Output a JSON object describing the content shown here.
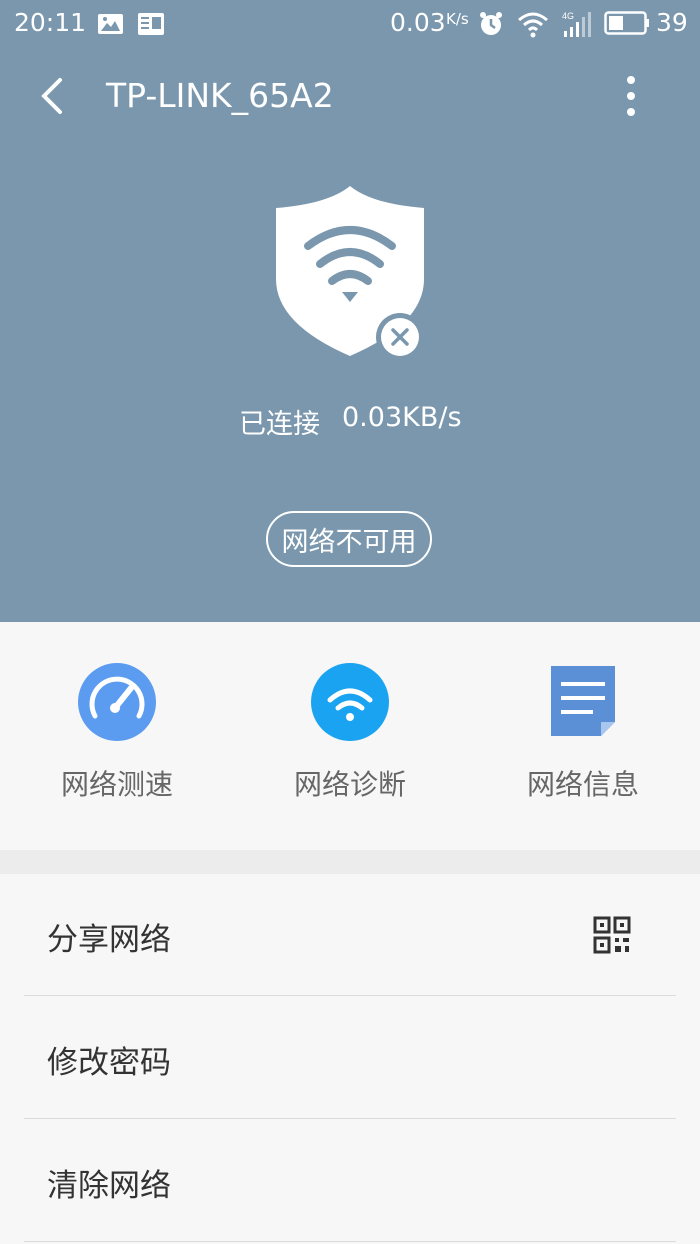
{
  "status_bar": {
    "time": "20:11",
    "net_speed": "0.03",
    "net_speed_unit": "K/s",
    "battery_level": "39",
    "icons": [
      "image-icon",
      "news-icon",
      "alarm-icon",
      "wifi-icon",
      "signal-4g-icon",
      "battery-icon"
    ]
  },
  "header": {
    "title": "TP-LINK_65A2",
    "back_icon": "chevron-left-icon",
    "more_icon": "more-vertical-icon"
  },
  "hero": {
    "shield_icon": "wifi-shield-icon",
    "status_text": "已连接",
    "speed_text": "0.03KB/s",
    "badge_text": "网络不可用",
    "bg_color": "#7a97ad"
  },
  "tools": [
    {
      "label": "网络测速",
      "icon": "speedometer-icon",
      "color": "#5b9bf0"
    },
    {
      "label": "网络诊断",
      "icon": "wifi-diagnose-icon",
      "color": "#1aa3f0"
    },
    {
      "label": "网络信息",
      "icon": "document-icon",
      "color": "#5b8fd6"
    }
  ],
  "menu": [
    {
      "label": "分享网络",
      "icon": "qr-code-icon"
    },
    {
      "label": "修改密码"
    },
    {
      "label": "清除网络"
    }
  ]
}
